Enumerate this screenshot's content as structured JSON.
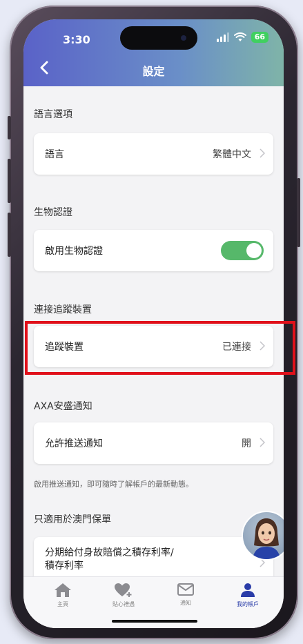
{
  "status_bar": {
    "time": "3:30",
    "battery": "66"
  },
  "header": {
    "title": "設定",
    "back_icon": "back-arrow-icon"
  },
  "sections": {
    "language": {
      "title": "語言選項",
      "item_label": "語言",
      "item_value": "繁體中文"
    },
    "biometric": {
      "title": "生物認證",
      "item_label": "啟用生物認證",
      "toggle_on": true
    },
    "tracker": {
      "title": "連接追蹤裝置",
      "item_label": "追蹤裝置",
      "item_value": "已連接"
    },
    "notifications": {
      "title": "AXA安盛通知",
      "item_label": "允許推送通知",
      "item_value": "開",
      "note": "啟用推送通知，即可隨時了解帳戶的最新動態。"
    },
    "macau": {
      "title": "只適用於澳門保單",
      "item_label_line1": "分期給付身故賠償之積存利率/",
      "item_label_line2": "積存利率"
    }
  },
  "tabbar": {
    "tabs": [
      {
        "label": "主頁",
        "icon": "home-icon"
      },
      {
        "label": "貼心禮遇",
        "icon": "heart-plus-icon"
      },
      {
        "label": "通知",
        "icon": "mail-icon"
      },
      {
        "label": "我的帳戶",
        "icon": "person-icon"
      }
    ],
    "active_index": 3
  },
  "colors": {
    "accent": "#2a3ca8",
    "toggle_on": "#56b86a",
    "highlight": "#e0101a"
  }
}
